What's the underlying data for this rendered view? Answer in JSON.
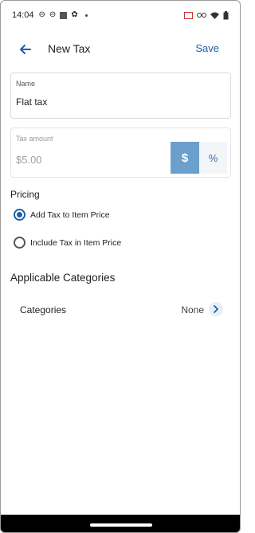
{
  "status_bar": {
    "time": "14:04"
  },
  "header": {
    "title": "New Tax",
    "save_label": "Save"
  },
  "name_field": {
    "label": "Name",
    "value": "Flat tax"
  },
  "tax_amount": {
    "label": "Tax amount",
    "value": "$5.00",
    "dollar_label": "$",
    "percent_label": "%"
  },
  "pricing": {
    "label": "Pricing",
    "options": [
      {
        "label": "Add Tax to Item Price",
        "selected": true
      },
      {
        "label": "Include Tax in Item Price",
        "selected": false
      }
    ]
  },
  "applicable_categories": {
    "heading": "Applicable Categories",
    "row_label": "Categories",
    "row_value": "None"
  },
  "colors": {
    "accent": "#1d5fa6",
    "segment_active": "#6c9fce"
  }
}
